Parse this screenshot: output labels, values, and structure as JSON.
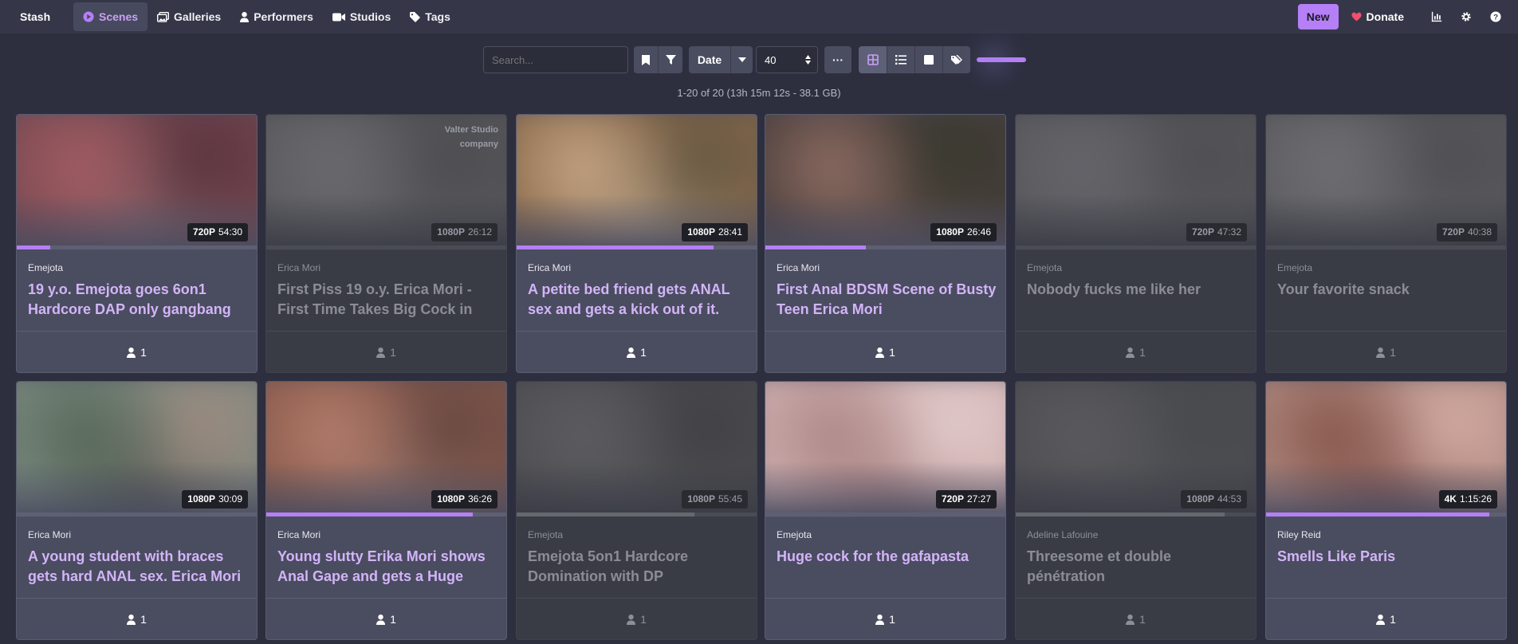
{
  "nav": {
    "brand": "Stash",
    "items": [
      {
        "label": "Scenes",
        "icon": "play-circle-icon",
        "active": true
      },
      {
        "label": "Galleries",
        "icon": "images-icon",
        "active": false
      },
      {
        "label": "Performers",
        "icon": "user-icon",
        "active": false
      },
      {
        "label": "Studios",
        "icon": "video-camera-icon",
        "active": false
      },
      {
        "label": "Tags",
        "icon": "tag-icon",
        "active": false
      }
    ],
    "new_label": "New",
    "donate_label": "Donate",
    "right_icons": [
      "bar-chart-icon",
      "gear-icon",
      "help-circle-icon"
    ],
    "accent_color": "#b57ff5"
  },
  "toolbar": {
    "search_placeholder": "Search...",
    "sort_label": "Date",
    "per_page": "40",
    "more_label": "···",
    "display_modes": [
      "grid-icon",
      "list-icon",
      "wall-icon",
      "tagger-icon"
    ],
    "active_mode": "grid-icon",
    "zoom_level": 1
  },
  "result_count": "1-20 of 20 (13h 15m 12s - 38.1 GB)",
  "scenes": [
    {
      "performer": "Emejota",
      "title": "19 y.o. Emejota goes 6on1 Hardcore DAP only gangbang",
      "res": "720P",
      "duration": "54:30",
      "progress": 0.14,
      "count": "1",
      "dim": false,
      "studio": "",
      "colors": [
        "#7a4a52",
        "#a05b62",
        "#5c3640",
        "#8a6d74"
      ]
    },
    {
      "performer": "Erica Mori",
      "title": "First Piss 19 o.y. Erica Mori - First Time Takes Big Cock in",
      "res": "1080P",
      "duration": "26:12",
      "progress": 0.0,
      "count": "1",
      "dim": true,
      "studio": "Valter Studio company",
      "colors": [
        "#5a5a5e",
        "#6a6a6e",
        "#4e4e52",
        "#606064"
      ]
    },
    {
      "performer": "Erica Mori",
      "title": "A petite bed friend gets ANAL sex and gets a kick out of it.",
      "res": "1080P",
      "duration": "28:41",
      "progress": 0.82,
      "count": "1",
      "dim": false,
      "studio": "",
      "colors": [
        "#8a6a4a",
        "#c0a080",
        "#6a5a44",
        "#b7a58f"
      ]
    },
    {
      "performer": "Erica Mori",
      "title": "First Anal BDSM Scene of Busty Teen Erica Mori",
      "res": "1080P",
      "duration": "26:46",
      "progress": 0.42,
      "count": "1",
      "dim": false,
      "studio": "",
      "colors": [
        "#4a3e3c",
        "#8a6a60",
        "#3a3a30",
        "#6b5550"
      ]
    },
    {
      "performer": "Emejota",
      "title": "Nobody fucks me like her",
      "res": "720P",
      "duration": "47:32",
      "progress": 0.0,
      "count": "1",
      "dim": true,
      "studio": "",
      "colors": [
        "#58585c",
        "#64646a",
        "#505054",
        "#5e5e62"
      ]
    },
    {
      "performer": "Emejota",
      "title": "Your favorite snack",
      "res": "720P",
      "duration": "40:38",
      "progress": 0.0,
      "count": "1",
      "dim": true,
      "studio": "",
      "colors": [
        "#5c5c60",
        "#6e6e72",
        "#505054",
        "#646468"
      ]
    },
    {
      "performer": "Erica Mori",
      "title": "A young student with braces gets hard ANAL sex. Erica Mori",
      "res": "1080P",
      "duration": "30:09",
      "progress": 0.0,
      "count": "1",
      "dim": false,
      "studio": "",
      "colors": [
        "#7a8a80",
        "#5a6a5c",
        "#9a8a80",
        "#4a5048"
      ]
    },
    {
      "performer": "Erica Mori",
      "title": "Young slutty Erika Mori shows Anal Gape and gets a Huge",
      "res": "1080P",
      "duration": "36:26",
      "progress": 0.86,
      "count": "1",
      "dim": false,
      "studio": "",
      "colors": [
        "#8a5a4a",
        "#b07a6a",
        "#6a4a44",
        "#9a7a70"
      ]
    },
    {
      "performer": "Emejota",
      "title": "Emejota 5on1 Hardcore Domination with DP",
      "res": "1080P",
      "duration": "55:45",
      "progress": 0.74,
      "count": "1",
      "dim": true,
      "studio": "",
      "colors": [
        "#4e4e52",
        "#5c5c60",
        "#424246",
        "#56565a"
      ]
    },
    {
      "performer": "Emejota",
      "title": "Huge cock for the gafapasta",
      "res": "720P",
      "duration": "27:27",
      "progress": 0.0,
      "count": "1",
      "dim": false,
      "studio": "",
      "colors": [
        "#d0b0b0",
        "#b08a8a",
        "#e0c8c8",
        "#a07878"
      ]
    },
    {
      "performer": "Adeline Lafouine",
      "title": "Threesome et double pénétration",
      "res": "1080P",
      "duration": "44:53",
      "progress": 0.87,
      "count": "1",
      "dim": true,
      "studio": "",
      "colors": [
        "#4e4e52",
        "#5a5a5e",
        "#484a4e",
        "#56565a"
      ]
    },
    {
      "performer": "Riley Reid",
      "title": "Smells Like Paris",
      "res": "4K",
      "duration": "1:15:26",
      "progress": 0.93,
      "count": "1",
      "dim": false,
      "studio": "",
      "colors": [
        "#b08a80",
        "#8a5a50",
        "#d0a8a0",
        "#7a4a44"
      ]
    }
  ]
}
